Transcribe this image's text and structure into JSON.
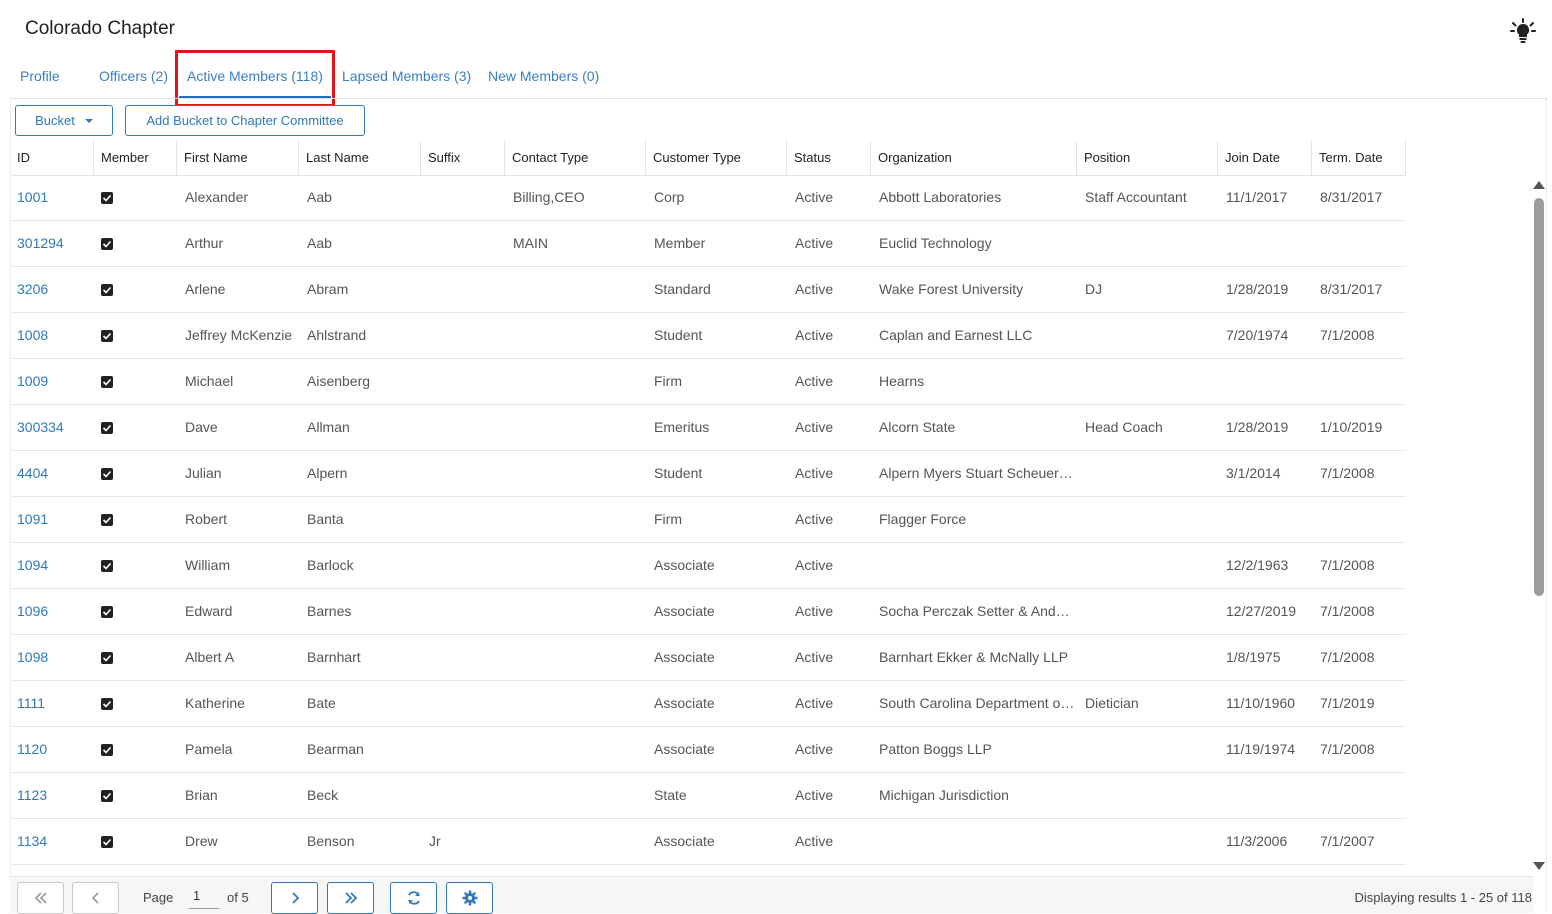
{
  "header": {
    "title": "Colorado Chapter",
    "tip_icon": "lightbulb-icon"
  },
  "tabs": [
    {
      "label": "Profile",
      "active": false
    },
    {
      "label": "Officers (2)",
      "active": false
    },
    {
      "label": "Active Members (118)",
      "active": true
    },
    {
      "label": "Lapsed Members (3)",
      "active": false
    },
    {
      "label": "New Members (0)",
      "active": false
    }
  ],
  "toolbar": {
    "bucket_label": "Bucket",
    "add_bucket_label": "Add Bucket to Chapter Committee"
  },
  "table": {
    "columns": [
      "ID",
      "Member",
      "First Name",
      "Last Name",
      "Suffix",
      "Contact Type",
      "Customer Type",
      "Status",
      "Organization",
      "Position",
      "Join Date",
      "Term. Date"
    ],
    "rows": [
      {
        "id": "1001",
        "first": "Alexander",
        "last": "Aab",
        "suffix": "",
        "contact": "Billing,CEO",
        "customer": "Corp",
        "status": "Active",
        "org": "Abbott Laboratories",
        "position": "Staff Accountant",
        "join": "11/1/2017",
        "term": "8/31/2017"
      },
      {
        "id": "301294",
        "first": "Arthur",
        "last": "Aab",
        "suffix": "",
        "contact": "MAIN",
        "customer": "Member",
        "status": "Active",
        "org": "Euclid Technology",
        "position": "",
        "join": "",
        "term": ""
      },
      {
        "id": "3206",
        "first": "Arlene",
        "last": "Abram",
        "suffix": "",
        "contact": "",
        "customer": "Standard",
        "status": "Active",
        "org": "Wake Forest University",
        "position": "DJ",
        "join": "1/28/2019",
        "term": "8/31/2017"
      },
      {
        "id": "1008",
        "first": "Jeffrey McKenzie",
        "last": "Ahlstrand",
        "suffix": "",
        "contact": "",
        "customer": "Student",
        "status": "Active",
        "org": "Caplan and Earnest LLC",
        "position": "",
        "join": "7/20/1974",
        "term": "7/1/2008"
      },
      {
        "id": "1009",
        "first": "Michael",
        "last": "Aisenberg",
        "suffix": "",
        "contact": "",
        "customer": "Firm",
        "status": "Active",
        "org": "Hearns",
        "position": "",
        "join": "",
        "term": ""
      },
      {
        "id": "300334",
        "first": "Dave",
        "last": "Allman",
        "suffix": "",
        "contact": "",
        "customer": "Emeritus",
        "status": "Active",
        "org": "Alcorn State",
        "position": "Head Coach",
        "join": "1/28/2019",
        "term": "1/10/2019"
      },
      {
        "id": "4404",
        "first": "Julian",
        "last": "Alpern",
        "suffix": "",
        "contact": "",
        "customer": "Student",
        "status": "Active",
        "org": "Alpern Myers Stuart Scheuer…",
        "position": "",
        "join": "3/1/2014",
        "term": "7/1/2008"
      },
      {
        "id": "1091",
        "first": "Robert",
        "last": "Banta",
        "suffix": "",
        "contact": "",
        "customer": "Firm",
        "status": "Active",
        "org": "Flagger Force",
        "position": "",
        "join": "",
        "term": ""
      },
      {
        "id": "1094",
        "first": "William",
        "last": "Barlock",
        "suffix": "",
        "contact": "",
        "customer": "Associate",
        "status": "Active",
        "org": "",
        "position": "",
        "join": "12/2/1963",
        "term": "7/1/2008"
      },
      {
        "id": "1096",
        "first": "Edward",
        "last": "Barnes",
        "suffix": "",
        "contact": "",
        "customer": "Associate",
        "status": "Active",
        "org": "Socha Perczak Setter & Ande…",
        "position": "",
        "join": "12/27/2019",
        "term": "7/1/2008"
      },
      {
        "id": "1098",
        "first": "Albert A",
        "last": "Barnhart",
        "suffix": "",
        "contact": "",
        "customer": "Associate",
        "status": "Active",
        "org": "Barnhart Ekker & McNally LLP",
        "position": "",
        "join": "1/8/1975",
        "term": "7/1/2008"
      },
      {
        "id": "1111",
        "first": "Katherine",
        "last": "Bate",
        "suffix": "",
        "contact": "",
        "customer": "Associate",
        "status": "Active",
        "org": "South Carolina Department o…",
        "position": "Dietician",
        "join": "11/10/1960",
        "term": "7/1/2019"
      },
      {
        "id": "1120",
        "first": "Pamela",
        "last": "Bearman",
        "suffix": "",
        "contact": "",
        "customer": "Associate",
        "status": "Active",
        "org": "Patton Boggs LLP",
        "position": "",
        "join": "11/19/1974",
        "term": "7/1/2008"
      },
      {
        "id": "1123",
        "first": "Brian",
        "last": "Beck",
        "suffix": "",
        "contact": "",
        "customer": "State",
        "status": "Active",
        "org": "Michigan Jurisdiction",
        "position": "",
        "join": "",
        "term": ""
      },
      {
        "id": "1134",
        "first": "Drew",
        "last": "Benson",
        "suffix": "Jr",
        "contact": "",
        "customer": "Associate",
        "status": "Active",
        "org": "",
        "position": "",
        "join": "11/3/2006",
        "term": "7/1/2007"
      }
    ]
  },
  "pagination": {
    "page_label": "Page",
    "page_value": "1",
    "of_label": "of 5",
    "results": "Displaying results 1 - 25 of 118"
  },
  "colors": {
    "accent": "#2f78bb",
    "highlight": "#e0151c"
  }
}
